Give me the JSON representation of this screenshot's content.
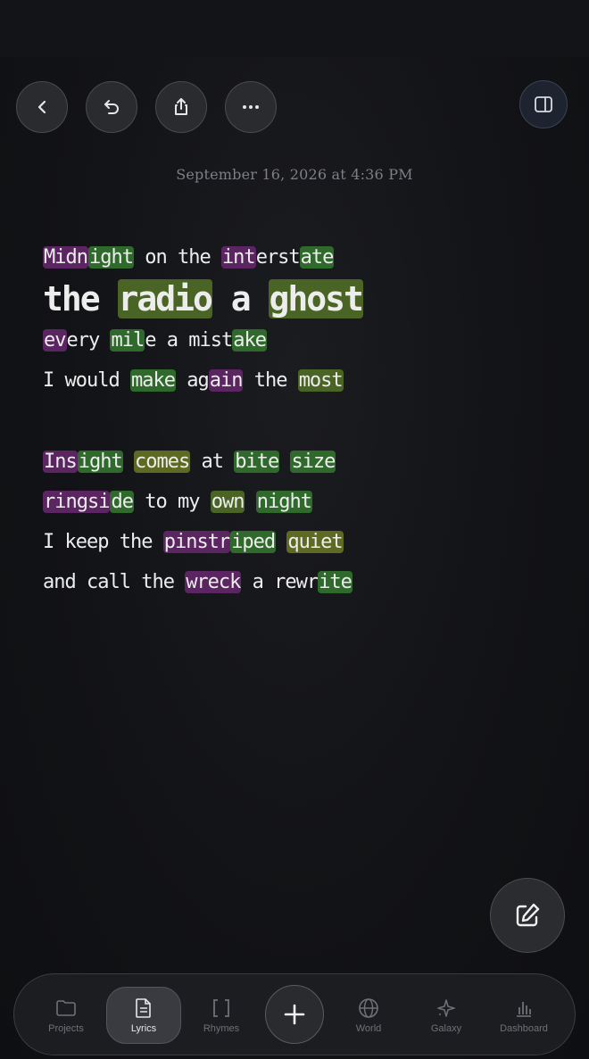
{
  "header": {
    "back_icon": "chevron-left-icon",
    "undo_icon": "undo-icon",
    "share_icon": "share-icon",
    "more_icon": "more-icon",
    "panel_icon": "sidebar-panel-icon"
  },
  "timestamp": "September 16, 2026 at 4:36 PM",
  "lyrics": {
    "lines": [
      [
        {
          "t": "Midn",
          "h": "p"
        },
        {
          "t": "ight",
          "h": "g"
        },
        {
          "t": " on the "
        },
        {
          "t": "int",
          "h": "p"
        },
        {
          "t": "erst"
        },
        {
          "t": "ate",
          "h": "g"
        }
      ],
      [
        {
          "t": "the "
        },
        {
          "t": "radio",
          "h": "olive"
        },
        {
          "t": " a "
        },
        {
          "t": "ghost",
          "h": "olive"
        }
      ],
      [
        {
          "t": "ev",
          "h": "p"
        },
        {
          "t": "ery "
        },
        {
          "t": "mil",
          "h": "g"
        },
        {
          "t": "e a mist"
        },
        {
          "t": "ake",
          "h": "g"
        }
      ],
      [
        {
          "t": "I would "
        },
        {
          "t": "make",
          "h": "g"
        },
        {
          "t": " ag"
        },
        {
          "t": "ain",
          "h": "p"
        },
        {
          "t": " the "
        },
        {
          "t": "most",
          "h": "olive"
        }
      ],
      [],
      [
        {
          "t": "Ins",
          "h": "p"
        },
        {
          "t": "ight",
          "h": "g"
        },
        {
          "t": " "
        },
        {
          "t": "comes",
          "h": "y"
        },
        {
          "t": " at "
        },
        {
          "t": "bite",
          "h": "g"
        },
        {
          "t": " "
        },
        {
          "t": "size",
          "h": "g"
        }
      ],
      [
        {
          "t": "ringsi",
          "h": "p"
        },
        {
          "t": "de",
          "h": "g"
        },
        {
          "t": " to my "
        },
        {
          "t": "own",
          "h": "olive"
        },
        {
          "t": " "
        },
        {
          "t": "night",
          "h": "g"
        }
      ],
      [
        {
          "t": "I keep the "
        },
        {
          "t": "pinstr",
          "h": "p"
        },
        {
          "t": "iped",
          "h": "g"
        },
        {
          "t": " "
        },
        {
          "t": "quiet",
          "h": "y"
        }
      ],
      [
        {
          "t": "and call the "
        },
        {
          "t": "wreck",
          "h": "p"
        },
        {
          "t": " a rewr"
        },
        {
          "t": "ite",
          "h": "g"
        }
      ]
    ],
    "highlight_colors": {
      "p": "#5a2560",
      "g": "#2f6a2c",
      "y": "#5e6a22",
      "olive": "#4a6426"
    }
  },
  "fab_icon": "edit-icon",
  "tabbar": {
    "tabs": [
      {
        "label": "Projects",
        "icon": "folder-icon"
      },
      {
        "label": "Lyrics",
        "icon": "document-icon",
        "active": true
      },
      {
        "label": "Rhymes",
        "icon": "brackets-icon"
      },
      {
        "label": "World",
        "icon": "globe-icon"
      },
      {
        "label": "Galaxy",
        "icon": "sparkle-icon"
      },
      {
        "label": "Dashboard",
        "icon": "bar-chart-icon"
      }
    ],
    "add_icon": "plus-icon"
  }
}
